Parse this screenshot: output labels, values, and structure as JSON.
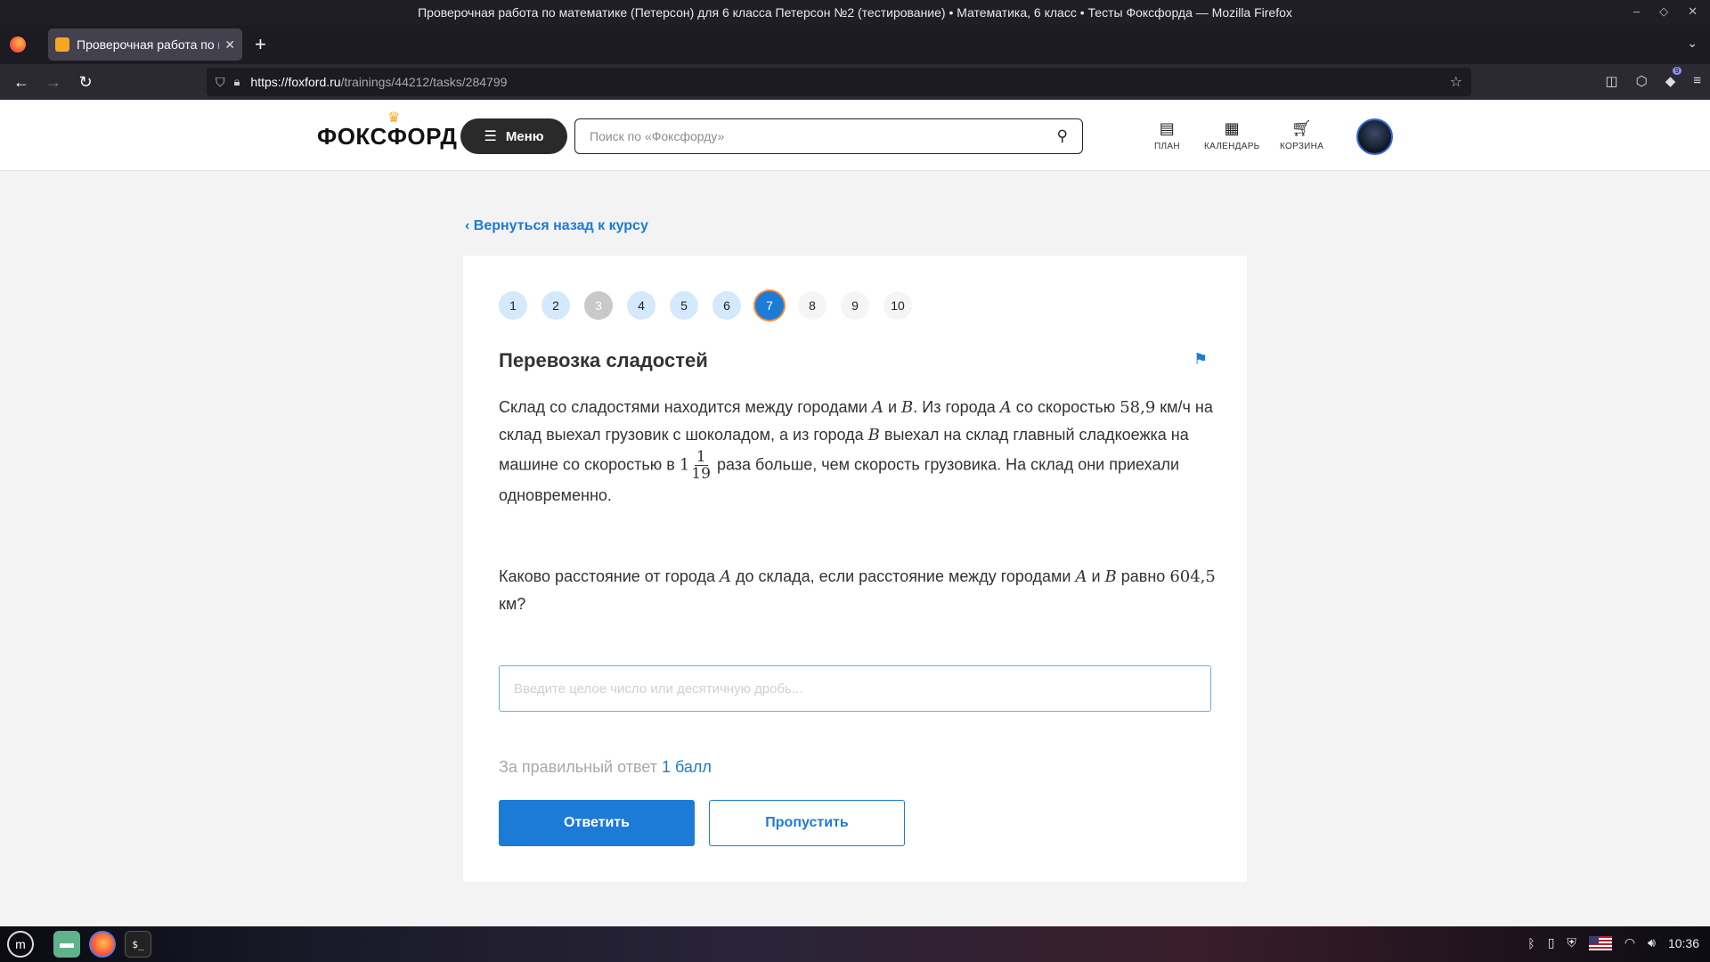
{
  "window": {
    "title": "Проверочная работа по математике (Петерсон) для 6 класса Петерсон №2 (тестирование) • Математика, 6 класс • Тесты Фоксфорда — Mozilla Firefox"
  },
  "tab": {
    "title": "Проверочная работа по м",
    "close": "✕"
  },
  "browser": {
    "url_host": "https://foxford.ru",
    "url_path": "/trainings/44212/tasks/284799",
    "extension_badge": "9"
  },
  "header": {
    "logo": "ФОКСФОРД",
    "menu_label": "Меню",
    "search_placeholder": "Поиск по «Фоксфорду»",
    "plan_label": "ПЛАН",
    "calendar_label": "КАЛЕНДАРЬ",
    "cart_label": "КОРЗИНА"
  },
  "back_link": "Вернуться назад к курсу",
  "steps": [
    {
      "label": "1",
      "state": "done"
    },
    {
      "label": "2",
      "state": "done"
    },
    {
      "label": "3",
      "state": "skipped"
    },
    {
      "label": "4",
      "state": "done"
    },
    {
      "label": "5",
      "state": "done"
    },
    {
      "label": "6",
      "state": "done"
    },
    {
      "label": "7",
      "state": "current"
    },
    {
      "label": "8",
      "state": "todo"
    },
    {
      "label": "9",
      "state": "todo"
    },
    {
      "label": "10",
      "state": "todo"
    }
  ],
  "task": {
    "title": "Перевозка сладостей",
    "p1": {
      "t1": "Склад со сладостями находится между городами ",
      "A": "A",
      "and": " и ",
      "B": "B",
      "t2": ". Из города ",
      "t3": " со скоростью ",
      "speed": "58,9",
      "t4": " км/ч на склад выехал грузовик с шоколадом, а из города ",
      "t5": " выехал на склад главный сладкоежка на машине со скоростью в ",
      "whole": "1",
      "num": "1",
      "den": "19",
      "t6": " раза больше, чем скорость грузовика. На склад они приехали одновременно."
    },
    "p2": {
      "t1": "Каково расстояние от города ",
      "t2": " до склада, если расстояние между городами ",
      "t3": " равно ",
      "dist": "604,5",
      "t4": " км?"
    },
    "answer_placeholder": "Введите целое число или десятичную дробь...",
    "score_text": "За правильный ответ ",
    "score_points": "1 балл",
    "answer_button": "Ответить",
    "skip_button": "Пропустить"
  },
  "taskbar": {
    "clock": "10:36"
  }
}
